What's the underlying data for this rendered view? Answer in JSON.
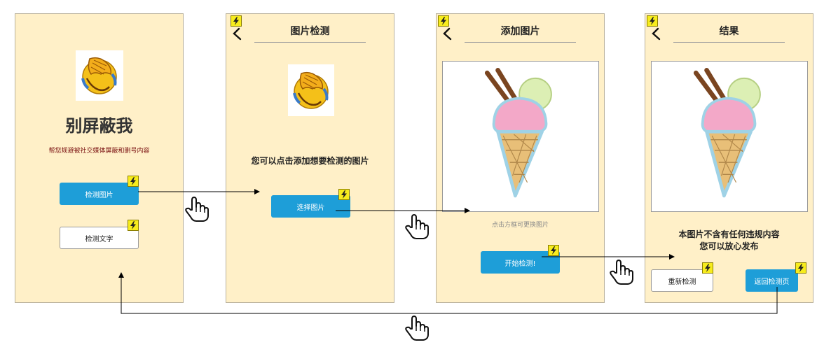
{
  "screens": {
    "home": {
      "app_title": "别屏蔽我",
      "subtitle": "帮您规避被社交媒体屏蔽和删号内容",
      "check_image_btn": "检测图片",
      "check_text_btn": "检测文字"
    },
    "image_check": {
      "title": "图片检测",
      "prompt": "您可以点击添加想要检测的图片",
      "select_btn": "选择图片"
    },
    "add_image": {
      "title": "添加图片",
      "hint": "点击方框可更换图片",
      "start_btn": "开始检测!"
    },
    "result": {
      "title": "结果",
      "message_line1": "本图片不含有任何违规内容",
      "message_line2": "您可以放心发布",
      "recheck_btn": "重新检测",
      "back_btn": "返回检测页"
    }
  },
  "icons": {
    "emoji": "facepalm-emoji",
    "image": "ice-cream-cone",
    "badge": "lightning-bolt",
    "back": "back-arrow",
    "cursor": "pointer-hand"
  },
  "colors": {
    "screen_bg": "#fff0c8",
    "button_blue": "#1e9ed8",
    "badge_yellow": "#f7ec1d",
    "subtitle_red": "#7a1010"
  }
}
